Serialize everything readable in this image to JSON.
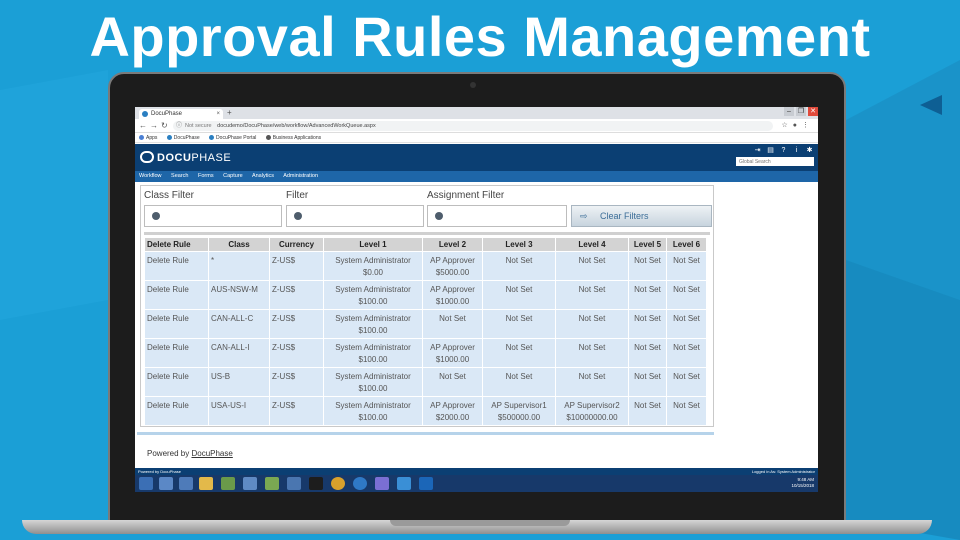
{
  "slide": {
    "title": "Approval Rules Management"
  },
  "browser": {
    "tab_title": "DocuPhase",
    "tab_close": "×",
    "new_tab": "+",
    "window_controls": [
      "–",
      "❐",
      "✕"
    ],
    "not_secure": "Not secure",
    "url": "docudemo/DocuPhase/web/workflow/AdvancedWorkQueue.aspx",
    "bookmarks": [
      "Apps",
      "DocuPhase",
      "DocuPhase Portal",
      "Business Applications"
    ]
  },
  "app": {
    "logo_bold": "DOCU",
    "logo_light": "PHASE",
    "search_placeholder": "Global Search",
    "menu": [
      "Workflow",
      "Search",
      "Forms",
      "Capture",
      "Analytics",
      "Administration"
    ]
  },
  "filters": {
    "class_label": "Class Filter",
    "filter_label": "Filter",
    "assignment_label": "Assignment Filter",
    "clear_label": "Clear Filters"
  },
  "table": {
    "headers": [
      "Delete Rule",
      "Class",
      "Currency",
      "Level 1",
      "Level 2",
      "Level 3",
      "Level 4",
      "Level 5",
      "Level 6"
    ],
    "rows": [
      {
        "delete": "Delete Rule",
        "class": "*",
        "currency": "Z-US$",
        "levels": [
          [
            "System Administrator",
            "$0.00"
          ],
          [
            "AP Approver",
            "$5000.00"
          ],
          [
            "Not Set",
            ""
          ],
          [
            "Not Set",
            ""
          ],
          [
            "Not Set",
            ""
          ],
          [
            "Not Set",
            ""
          ]
        ]
      },
      {
        "delete": "Delete Rule",
        "class": "AUS-NSW-M",
        "currency": "Z-US$",
        "levels": [
          [
            "System Administrator",
            "$100.00"
          ],
          [
            "AP Approver",
            "$1000.00"
          ],
          [
            "Not Set",
            ""
          ],
          [
            "Not Set",
            ""
          ],
          [
            "Not Set",
            ""
          ],
          [
            "Not Set",
            ""
          ]
        ]
      },
      {
        "delete": "Delete Rule",
        "class": "CAN-ALL-C",
        "currency": "Z-US$",
        "levels": [
          [
            "System Administrator",
            "$100.00"
          ],
          [
            "Not Set",
            ""
          ],
          [
            "Not Set",
            ""
          ],
          [
            "Not Set",
            ""
          ],
          [
            "Not Set",
            ""
          ],
          [
            "Not Set",
            ""
          ]
        ]
      },
      {
        "delete": "Delete Rule",
        "class": "CAN-ALL-I",
        "currency": "Z-US$",
        "levels": [
          [
            "System Administrator",
            "$100.00"
          ],
          [
            "AP Approver",
            "$1000.00"
          ],
          [
            "Not Set",
            ""
          ],
          [
            "Not Set",
            ""
          ],
          [
            "Not Set",
            ""
          ],
          [
            "Not Set",
            ""
          ]
        ]
      },
      {
        "delete": "Delete Rule",
        "class": "US-B",
        "currency": "Z-US$",
        "levels": [
          [
            "System Administrator",
            "$100.00"
          ],
          [
            "Not Set",
            ""
          ],
          [
            "Not Set",
            ""
          ],
          [
            "Not Set",
            ""
          ],
          [
            "Not Set",
            ""
          ],
          [
            "Not Set",
            ""
          ]
        ]
      },
      {
        "delete": "Delete Rule",
        "class": "USA-US-I",
        "currency": "Z-US$",
        "levels": [
          [
            "System Administrator",
            "$100.00"
          ],
          [
            "AP Approver",
            "$2000.00"
          ],
          [
            "AP Supervisor1",
            "$500000.00"
          ],
          [
            "AP Supervisor2",
            "$10000000.00"
          ],
          [
            "Not Set",
            ""
          ],
          [
            "Not Set",
            ""
          ]
        ]
      }
    ]
  },
  "footer": {
    "powered_prefix": "Powered by ",
    "powered_link": "DocuPhase",
    "status_left": "Powered by DocuPhase",
    "status_right": "Logged in As: System Administrator"
  },
  "taskbar": {
    "time": "9:48 AM",
    "date": "10/15/2018"
  },
  "colors": {
    "background": "#1b9fd6",
    "header": "#0b3f73",
    "menubar": "#1e66a8",
    "row": "#dae8f6",
    "header_cell": "#d3d3d3"
  }
}
